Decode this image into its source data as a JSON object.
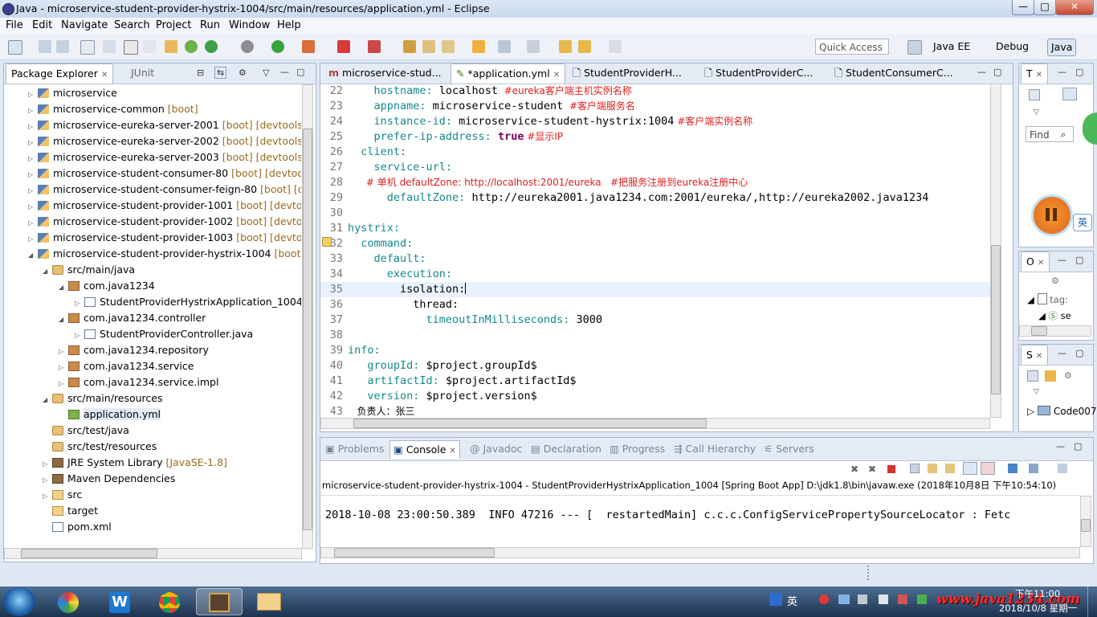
{
  "window": {
    "title": "Java - microservice-student-provider-hystrix-1004/src/main/resources/application.yml - Eclipse",
    "min": "—",
    "max": "□",
    "close": "✕"
  },
  "menu": [
    "File",
    "Edit",
    "Navigate",
    "Search",
    "Project",
    "Run",
    "Window",
    "Help"
  ],
  "toolbar": {
    "quick_access_placeholder": "Quick Access",
    "perspectives": [
      "Java EE",
      "Debug",
      "Java"
    ]
  },
  "explorer": {
    "tabs": [
      "Package Explorer",
      "JUnit"
    ],
    "rows": [
      {
        "label": "microservice",
        "dec": ""
      },
      {
        "label": "microservice-common",
        "dec": "[boot]"
      },
      {
        "label": "microservice-eureka-server-2001",
        "dec": "[boot] [devtools]"
      },
      {
        "label": "microservice-eureka-server-2002",
        "dec": "[boot] [devtools]"
      },
      {
        "label": "microservice-eureka-server-2003",
        "dec": "[boot] [devtools]"
      },
      {
        "label": "microservice-student-consumer-80",
        "dec": "[boot] [devtools]"
      },
      {
        "label": "microservice-student-consumer-feign-80",
        "dec": "[boot] [dev"
      },
      {
        "label": "microservice-student-provider-1001",
        "dec": "[boot] [devtools"
      },
      {
        "label": "microservice-student-provider-1002",
        "dec": "[boot] [devtools"
      },
      {
        "label": "microservice-student-provider-1003",
        "dec": "[boot] [devtools"
      },
      {
        "label": "microservice-student-provider-hystrix-1004",
        "dec": "[boot] [d"
      },
      {
        "label": "src/main/java",
        "dec": ""
      },
      {
        "label": "com.java1234",
        "dec": ""
      },
      {
        "label": "StudentProviderHystrixApplication_1004.jav",
        "dec": ""
      },
      {
        "label": "com.java1234.controller",
        "dec": ""
      },
      {
        "label": "StudentProviderController.java",
        "dec": ""
      },
      {
        "label": "com.java1234.repository",
        "dec": ""
      },
      {
        "label": "com.java1234.service",
        "dec": ""
      },
      {
        "label": "com.java1234.service.impl",
        "dec": ""
      },
      {
        "label": "src/main/resources",
        "dec": ""
      },
      {
        "label": "application.yml",
        "dec": ""
      },
      {
        "label": "src/test/java",
        "dec": ""
      },
      {
        "label": "src/test/resources",
        "dec": ""
      },
      {
        "label": "JRE System Library",
        "dec": "[JavaSE-1.8]"
      },
      {
        "label": "Maven Dependencies",
        "dec": ""
      },
      {
        "label": "src",
        "dec": ""
      },
      {
        "label": "target",
        "dec": ""
      },
      {
        "label": "pom.xml",
        "dec": ""
      }
    ]
  },
  "editor": {
    "tabs": [
      "microservice-stud...",
      "*application.yml",
      "StudentProviderH...",
      "StudentProviderC...",
      "StudentConsumerC..."
    ],
    "lines": [
      {
        "n": "22",
        "key": "    hostname:",
        "val": " localhost",
        "cmt": "  #eureka客户端主机实例名称"
      },
      {
        "n": "23",
        "key": "    appname:",
        "val": " microservice-student",
        "cmt": "  #客户端服务名"
      },
      {
        "n": "24",
        "key": "    instance-id:",
        "val": " microservice-student-hystrix:1004",
        "cmt": " #客户端实例名称"
      },
      {
        "n": "25",
        "key": "    prefer-ip-address:",
        "val": " true",
        "cmt": " #显示IP"
      },
      {
        "n": "26",
        "key": "  client:",
        "val": "",
        "cmt": ""
      },
      {
        "n": "27",
        "key": "    service-url:",
        "val": "",
        "cmt": ""
      },
      {
        "n": "28",
        "key": "",
        "val": "",
        "cmt": "      # 单机 defaultZone: http://localhost:2001/eureka   #把服务注册到eureka注册中心"
      },
      {
        "n": "29",
        "key": "      defaultZone:",
        "val": " http://eureka2001.java1234.com:2001/eureka/,http://eureka2002.java1234",
        "cmt": ""
      },
      {
        "n": "30",
        "key": "",
        "val": "",
        "cmt": ""
      },
      {
        "n": "31",
        "key": "hystrix:",
        "val": "",
        "cmt": ""
      },
      {
        "n": "32",
        "key": "  command:",
        "val": "",
        "cmt": ""
      },
      {
        "n": "33",
        "key": "    default:",
        "val": "",
        "cmt": ""
      },
      {
        "n": "34",
        "key": "      execution:",
        "val": "",
        "cmt": ""
      },
      {
        "n": "35",
        "key": "        isolation:",
        "val": "",
        "cmt": ""
      },
      {
        "n": "36",
        "key": "          thread:",
        "val": "",
        "cmt": ""
      },
      {
        "n": "37",
        "key": "            timeoutInMilliseconds:",
        "val": " 3000",
        "cmt": ""
      },
      {
        "n": "38",
        "key": "",
        "val": "",
        "cmt": ""
      },
      {
        "n": "39",
        "key": "info:",
        "val": "",
        "cmt": ""
      },
      {
        "n": "40",
        "key": "   groupId:",
        "val": " $project.groupId$",
        "cmt": ""
      },
      {
        "n": "41",
        "key": "   artifactId:",
        "val": " $project.artifactId$",
        "cmt": ""
      },
      {
        "n": "42",
        "key": "   version:",
        "val": " $project.version$",
        "cmt": ""
      },
      {
        "n": "43",
        "key": "",
        "val": "   负责人：张三",
        "cmt": ""
      }
    ]
  },
  "right_panels": {
    "task_tab": "T",
    "find_placeholder": "Find",
    "outline_tab": "O",
    "outline_item1": "tag:",
    "outline_item2": "se",
    "servers_tab": "S",
    "servers_item": "Code007"
  },
  "console": {
    "tabs": [
      "Problems",
      "Console",
      "Javadoc",
      "Declaration",
      "Progress",
      "Call Hierarchy",
      "Servers"
    ],
    "header": "microservice-student-provider-hystrix-1004 - StudentProviderHystrixApplication_1004 [Spring Boot App] D:\\jdk1.8\\bin\\javaw.exe (2018年10月8日 下午10:54:10)",
    "log_line": "2018-10-08 23:00:50.389  INFO 47216 --- [  restartedMain] c.c.c.ConfigServicePropertySourceLocator : Fetc"
  },
  "overlay": {
    "ime_badge": "英",
    "watermark": "www.java1234.com"
  },
  "taskbar": {
    "ime": "英",
    "clock_time": "下午11:00",
    "clock_date": "2018/10/8 星期一"
  }
}
